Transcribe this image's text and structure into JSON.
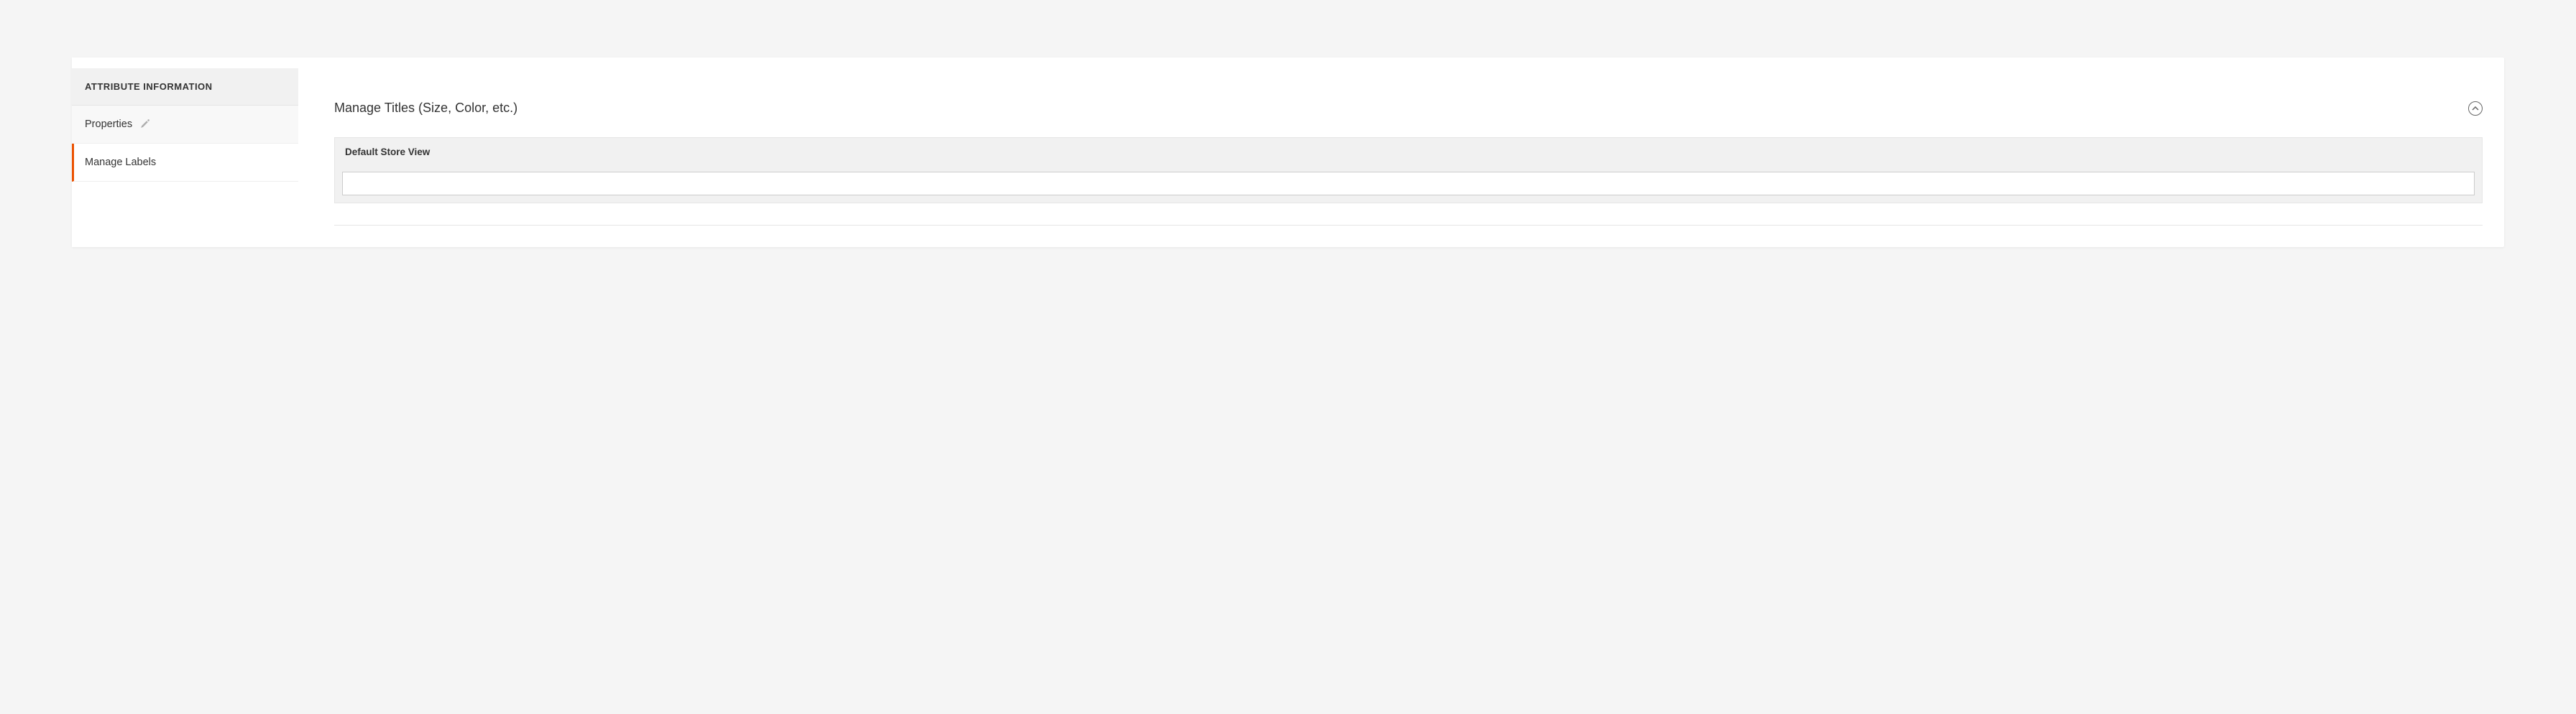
{
  "sidebar": {
    "header": "ATTRIBUTE INFORMATION",
    "items": [
      {
        "label": "Properties",
        "hasEdit": true
      },
      {
        "label": "Manage Labels",
        "hasEdit": false
      }
    ]
  },
  "main": {
    "section_title": "Manage Titles (Size, Color, etc.)",
    "column_header": "Default Store View",
    "input_value": ""
  }
}
